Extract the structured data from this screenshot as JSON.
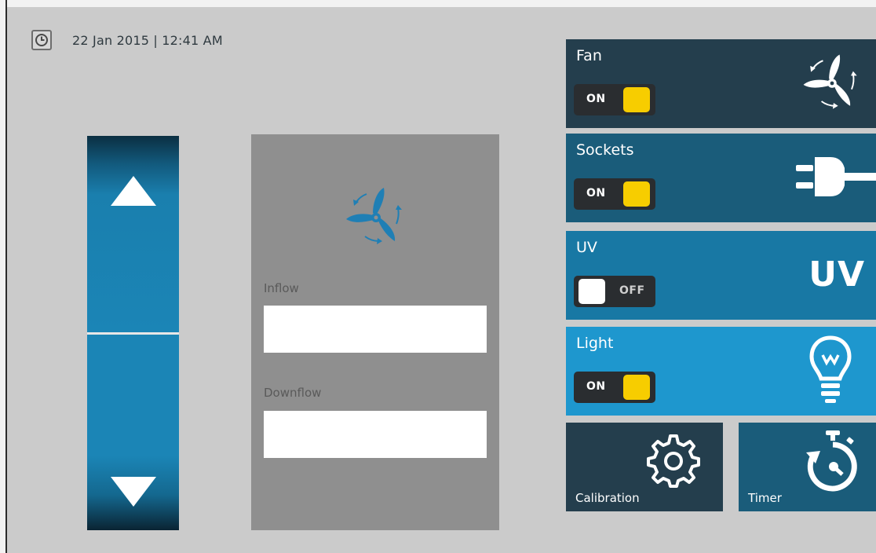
{
  "header": {
    "datetime": "22 Jan 2015 | 12:41 AM"
  },
  "flow": {
    "inflow_label": "Inflow",
    "inflow_value": "",
    "downflow_label": "Downflow",
    "downflow_value": ""
  },
  "controls": {
    "fan": {
      "title": "Fan",
      "state": "ON"
    },
    "sockets": {
      "title": "Sockets",
      "state": "ON"
    },
    "uv": {
      "title": "UV",
      "state": "OFF",
      "icon_text": "UV"
    },
    "light": {
      "title": "Light",
      "state": "ON"
    }
  },
  "buttons": {
    "calibration": "Calibration",
    "timer": "Timer"
  },
  "icons": {
    "clock": "clock-icon",
    "up": "arrow-up-icon",
    "down": "arrow-down-icon",
    "fan": "fan-icon",
    "plug": "plug-icon",
    "bulb": "lightbulb-icon",
    "gear": "gear-icon",
    "stopwatch": "stopwatch-icon"
  },
  "colors": {
    "toggle_on": "#f7cd00",
    "tile_dark": "#243e4d",
    "tile_light": "#1e97ce",
    "accent_blue": "#1b85b6"
  }
}
